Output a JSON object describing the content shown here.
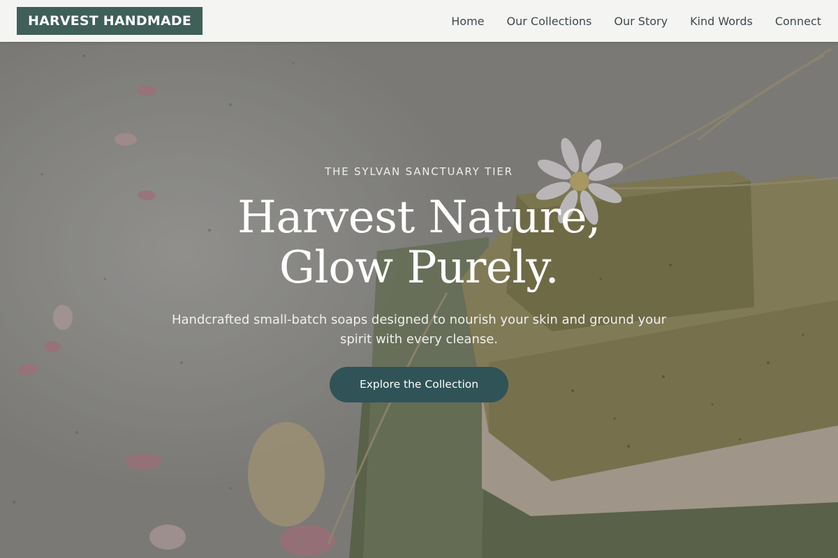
{
  "header": {
    "brand": "HARVEST HANDMADE",
    "nav": [
      {
        "label": "Home"
      },
      {
        "label": "Our Collections"
      },
      {
        "label": "Our Story"
      },
      {
        "label": "Kind Words"
      },
      {
        "label": "Connect"
      }
    ]
  },
  "hero": {
    "eyebrow": "THE SYLVAN SANCTUARY TIER",
    "headline_line1": "Harvest Nature,",
    "headline_line2": "Glow Purely.",
    "subtext": "Handcrafted small-batch soaps designed to nourish your skin and ground your spirit with every cleanse.",
    "cta_label": "Explore the Collection",
    "background_image": "soap-bars-with-daisy-photo"
  },
  "colors": {
    "brand": "#3f5f58",
    "cta": "#2f5356",
    "header_bg": "#f4f4f3",
    "nav_text": "#3d4a4e"
  }
}
